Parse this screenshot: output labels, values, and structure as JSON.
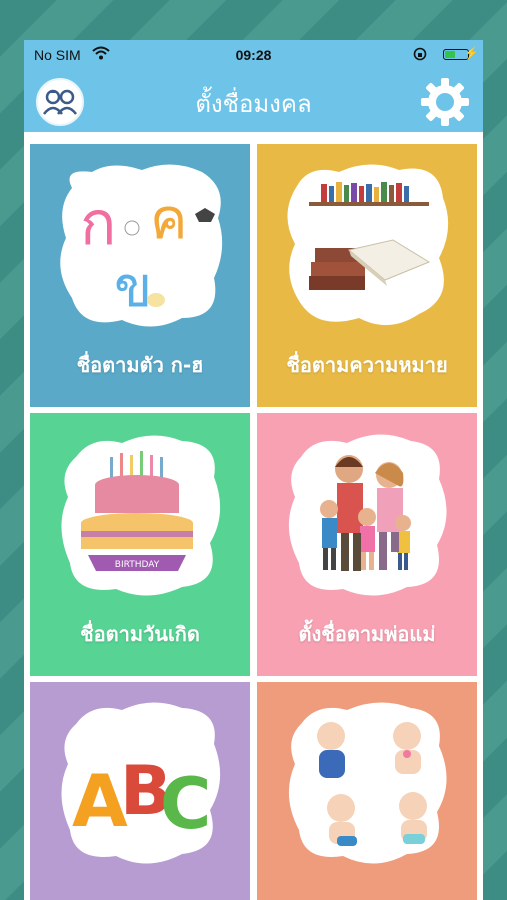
{
  "status": {
    "carrier": "No SIM",
    "time": "09:28"
  },
  "header": {
    "title": "ตั้งชื่อมงคล"
  },
  "icons": {
    "profile": "parents-avatar-icon",
    "settings": "gear-icon"
  },
  "letters": {
    "k": "ก",
    "kh": "ค",
    "kho": "ข",
    "abc": [
      "A",
      "B",
      "C"
    ],
    "birthday": "BIRTHDAY"
  },
  "tiles": [
    {
      "label": "ชื่อตามตัว ก-ฮ",
      "color": "#5aa9c8"
    },
    {
      "label": "ชื่อตามความหมาย",
      "color": "#e8ba45"
    },
    {
      "label": "ชื่อตามวันเกิด",
      "color": "#57d394"
    },
    {
      "label": "ตั้งชื่อตามพ่อแม่",
      "color": "#f7a1b3"
    },
    {
      "label": "",
      "color": "#b79cd2"
    },
    {
      "label": "",
      "color": "#ee9c7b"
    }
  ]
}
